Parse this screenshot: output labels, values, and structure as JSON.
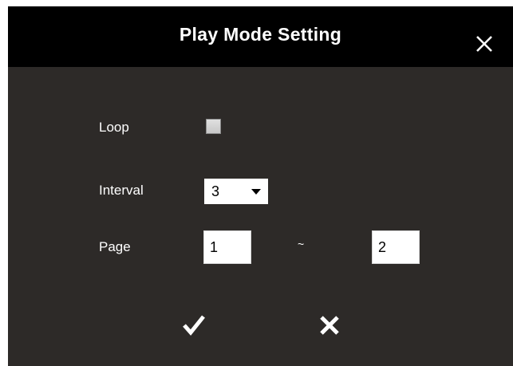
{
  "dialog": {
    "title": "Play Mode Setting",
    "close_icon": "close-icon"
  },
  "form": {
    "loop": {
      "label": "Loop",
      "checked": false
    },
    "interval": {
      "label": "Interval",
      "selected": "3"
    },
    "page": {
      "label": "Page",
      "from": "1",
      "separator": "~",
      "to": "2"
    }
  },
  "actions": {
    "confirm_icon": "checkmark-icon",
    "cancel_icon": "close-icon"
  },
  "colors": {
    "title_bar": "#000000",
    "dialog_body": "#2d2a28",
    "text": "#ffffff"
  }
}
